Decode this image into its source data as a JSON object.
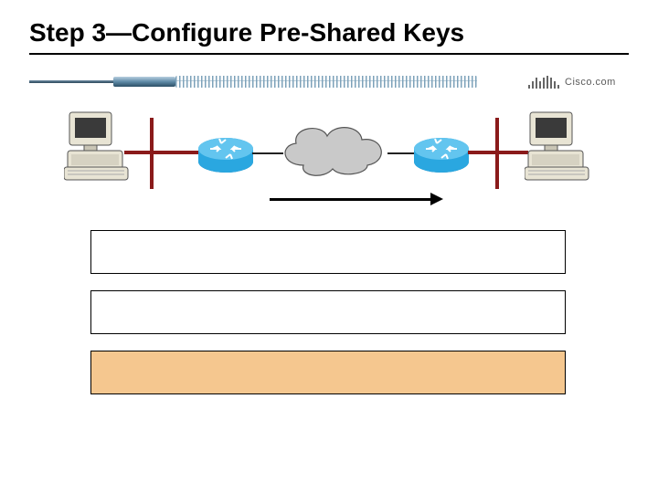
{
  "title": "Step 3—Configure Pre-Shared Keys",
  "brand": "Cisco.com",
  "logo_bars": [
    4,
    8,
    12,
    8,
    12,
    14,
    12,
    8,
    4
  ],
  "diagram": {
    "left_pc": "workstation-a",
    "right_pc": "workstation-b",
    "router_a": "router-a",
    "router_b": "router-b",
    "cloud": "wan-cloud",
    "arrow_dir": "right"
  },
  "boxes": {
    "box1": "",
    "box2": "",
    "box3": ""
  },
  "colors": {
    "accent_bar": "#8a1a1a",
    "router": "#2aa7e0",
    "cloud": "#c9c9c9",
    "tan": "#f5c78f"
  }
}
